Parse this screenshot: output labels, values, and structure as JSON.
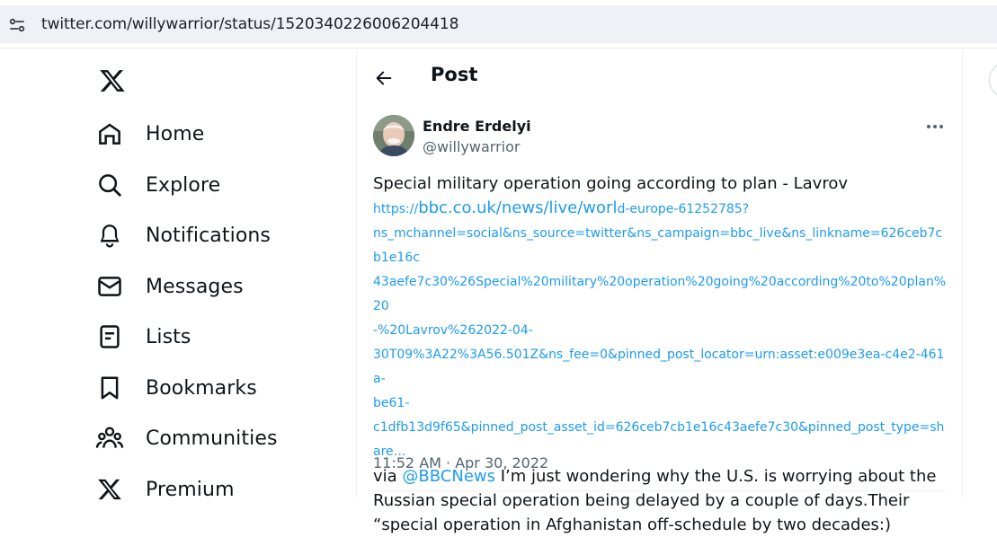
{
  "browser": {
    "url": "twitter.com/willywarrior/status/1520340226006204418"
  },
  "sidebar": {
    "items": [
      {
        "label": "Home",
        "icon": "home-icon"
      },
      {
        "label": "Explore",
        "icon": "search-icon"
      },
      {
        "label": "Notifications",
        "icon": "bell-icon"
      },
      {
        "label": "Messages",
        "icon": "mail-icon"
      },
      {
        "label": "Lists",
        "icon": "list-icon"
      },
      {
        "label": "Bookmarks",
        "icon": "bookmark-icon"
      },
      {
        "label": "Communities",
        "icon": "people-icon"
      },
      {
        "label": "Premium",
        "icon": "x-logo-icon"
      }
    ]
  },
  "header": {
    "title": "Post"
  },
  "post": {
    "author_name": "Endre Erdelyi",
    "author_handle": "@willywarrior",
    "text_line1": "Special military operation going according to plan - Lavrov",
    "url_prefix": "https://",
    "url_big": "bbc.co.uk/news/live/worl",
    "url_rest1": "d-europe-61252785?",
    "url_line2": "ns_mchannel=social&ns_source=twitter&ns_campaign=bbc_live&ns_linkname=626ceb7cb1e16c",
    "url_line3": "43aefe7c30%26Special%20military%20operation%20going%20according%20to%20plan%20",
    "url_line4": "-%20Lavrov%262022-04-",
    "url_line5": "30T09%3A22%3A56.501Z&ns_fee=0&pinned_post_locator=urn:asset:e009e3ea-c4e2-461a-",
    "url_line6": "be61-",
    "url_line7": "c1dfb13d9f65&pinned_post_asset_id=626ceb7cb1e16c43aefe7c30&pinned_post_type=share…",
    "via": "via ",
    "mention": "@BBCNews",
    "text_after_mention": " I’m just wondering why the U.S. is worrying about the",
    "text_line3": "Russian special operation being delayed by a couple of days.Their",
    "text_line4": "“special operation in Afghanistan off-schedule by two decades:)",
    "timestamp": "11:52 AM · Apr 30, 2022"
  },
  "colors": {
    "link": "#1d9bf0",
    "secondary_text": "#536471",
    "primary_text": "#0f1419"
  }
}
